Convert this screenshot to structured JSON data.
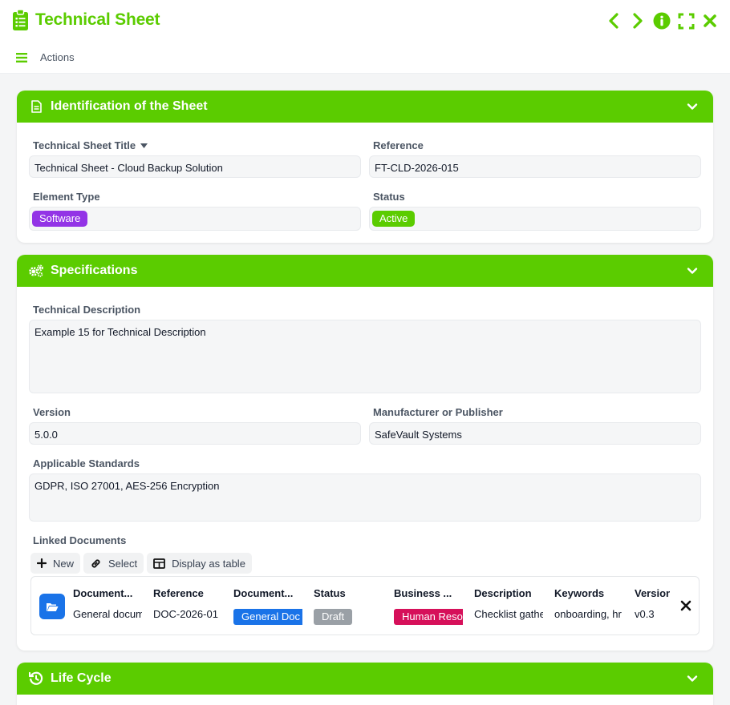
{
  "app": {
    "title": "Technical Sheet",
    "accent_color": "#5bcc00",
    "controls": [
      "chevron-left-icon",
      "chevron-right-icon",
      "info-icon",
      "fullscreen-icon",
      "close-icon"
    ]
  },
  "menu": {
    "actions_label": "Actions"
  },
  "identification": {
    "title": "Identification of the Sheet",
    "fields": {
      "sheet_title_label": "Technical Sheet Title",
      "sheet_title_value": "Technical Sheet - Cloud Backup Solution",
      "reference_label": "Reference",
      "reference_value": "FT-CLD-2026-015",
      "element_type_label": "Element Type",
      "element_type_value": "Software",
      "element_type_color": "#9334e6",
      "status_label": "Status",
      "status_value": "Active",
      "status_color": "#5bcc00"
    }
  },
  "specifications": {
    "title": "Specifications",
    "fields": {
      "tech_desc_label": "Technical Description",
      "tech_desc_value": "Example 15 for Technical Description",
      "version_label": "Version",
      "version_value": "5.0.0",
      "manufacturer_label": "Manufacturer or Publisher",
      "manufacturer_value": "SafeVault Systems",
      "standards_label": "Applicable Standards",
      "standards_value": "GDPR, ISO 27001, AES-256 Encryption"
    },
    "linked_documents": {
      "label": "Linked Documents",
      "buttons": {
        "new": "New",
        "select": "Select",
        "display_table": "Display as table"
      },
      "columns": [
        "Document...",
        "Reference",
        "Document...",
        "Status",
        "Business ...",
        "Description",
        "Keywords",
        "Version"
      ],
      "row": {
        "name": "General document",
        "reference": "DOC-2026-01",
        "doc_type": "General Doc",
        "doc_type_color": "#1a73e8",
        "status": "Draft",
        "status_color": "#9aa0a6",
        "business": "Human Resources",
        "business_color": "#d6105a",
        "description": "Checklist gathering",
        "keywords": "onboarding, hr",
        "version": "v0.3"
      }
    }
  },
  "lifecycle": {
    "title": "Life Cycle"
  }
}
